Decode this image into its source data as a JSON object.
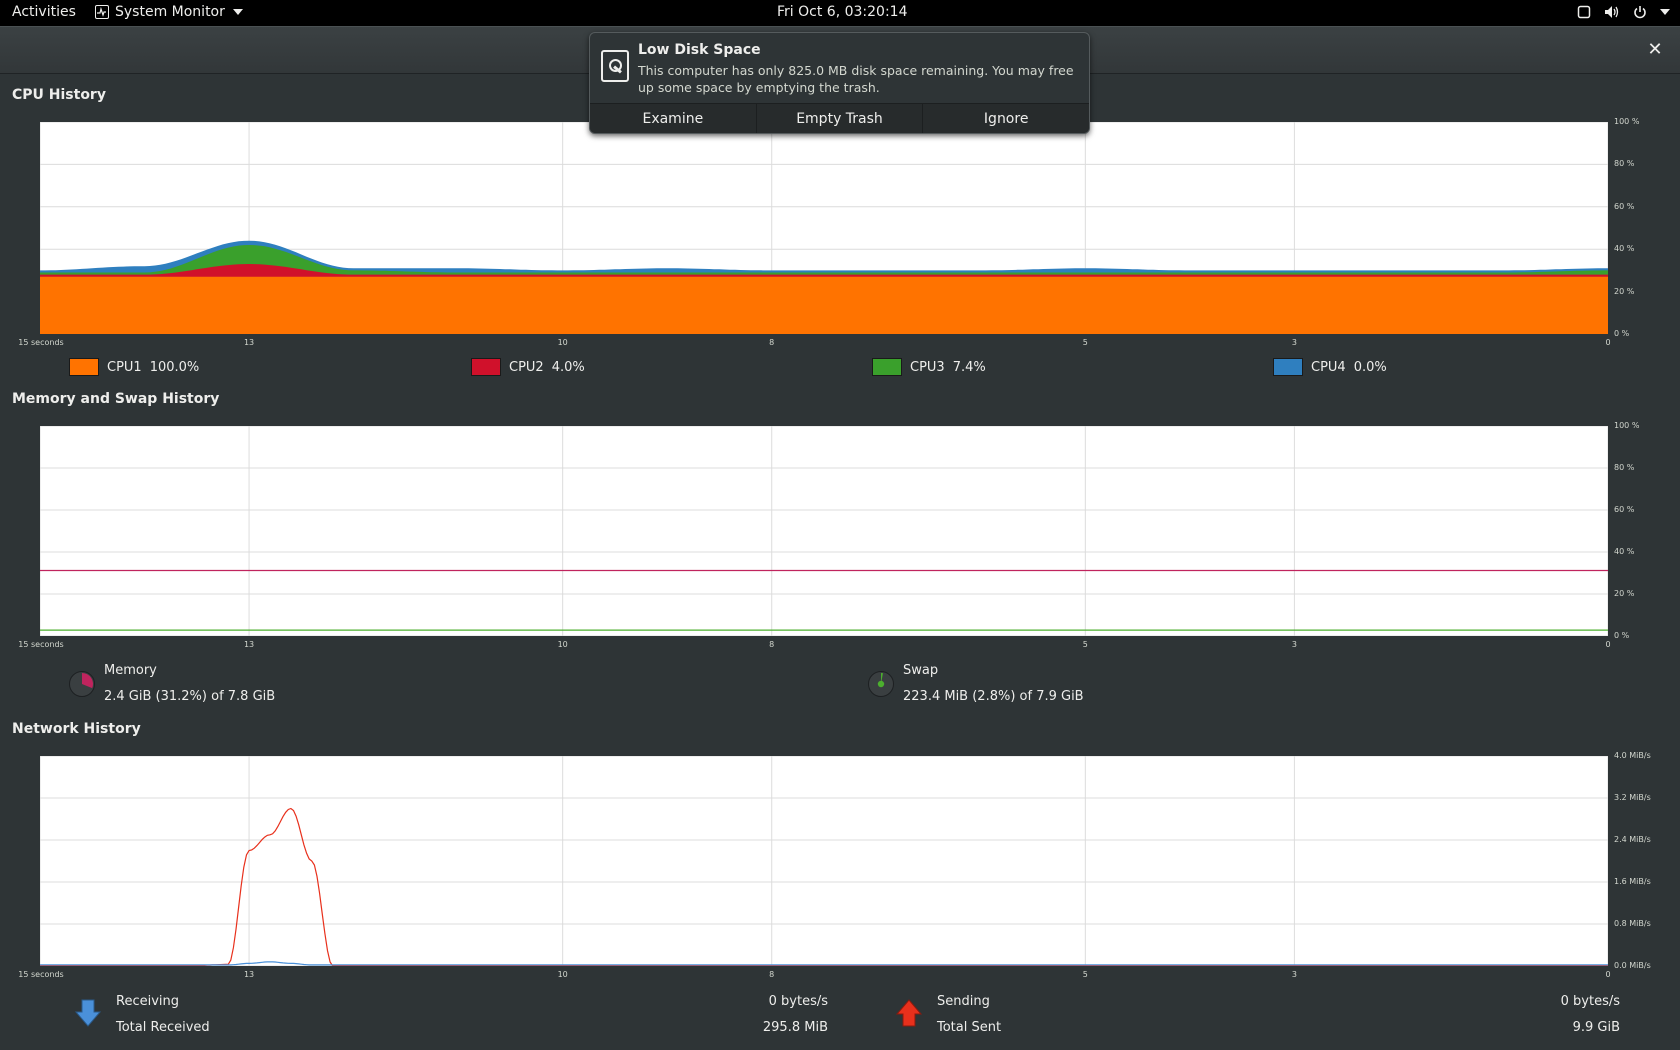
{
  "topbar": {
    "activities": "Activities",
    "app_name": "System Monitor",
    "clock": "Fri Oct  6, 03:20:14"
  },
  "notification": {
    "title": "Low Disk Space",
    "body": "This computer has only 825.0 MB disk space remaining.  You may free up some space by emptying the trash.",
    "actions": [
      "Examine",
      "Empty Trash",
      "Ignore"
    ]
  },
  "sections": {
    "cpu": "CPU History",
    "memory": "Memory and Swap History",
    "network": "Network History"
  },
  "x_axis_labels": [
    "15 seconds",
    "13",
    "10",
    "8",
    "5",
    "3",
    "0"
  ],
  "cpu_y_labels": [
    "100 %",
    "80 %",
    "60 %",
    "40 %",
    "20 %",
    "0 %"
  ],
  "mem_y_labels": [
    "100 %",
    "80 %",
    "60 %",
    "40 %",
    "20 %",
    "0 %"
  ],
  "net_y_labels": [
    "4.0 MiB/s",
    "3.2 MiB/s",
    "2.4 MiB/s",
    "1.6 MiB/s",
    "0.8 MiB/s",
    "0.0 MiB/s"
  ],
  "cpu_legend": [
    {
      "name": "CPU1",
      "value": "100.0%",
      "color": "#ff7300"
    },
    {
      "name": "CPU2",
      "value": "4.0%",
      "color": "#d0112b"
    },
    {
      "name": "CPU3",
      "value": "7.4%",
      "color": "#3aa02c"
    },
    {
      "name": "CPU4",
      "value": "0.0%",
      "color": "#2f7fbf"
    }
  ],
  "memory": {
    "label": "Memory",
    "value": "2.4 GiB (31.2%) of 7.8 GiB",
    "color": "#c0245e",
    "percent": 31.2
  },
  "swap": {
    "label": "Swap",
    "value": "223.4 MiB (2.8%) of 7.9 GiB",
    "color": "#4caf2e",
    "percent": 2.8
  },
  "network": {
    "receiving_label": "Receiving",
    "receiving_value": "0 bytes/s",
    "total_received_label": "Total Received",
    "total_received_value": "295.8 MiB",
    "sending_label": "Sending",
    "sending_value": "0 bytes/s",
    "total_sent_label": "Total Sent",
    "total_sent_value": "9.9 GiB",
    "receiving_color": "#4a90d9",
    "sending_color": "#e8301c"
  },
  "chart_data": [
    {
      "type": "area",
      "xlabel": "",
      "ylabel": "",
      "ylim": [
        0,
        100
      ],
      "x": [
        15,
        14,
        13,
        12,
        11,
        10,
        9,
        8,
        7,
        6,
        5,
        4,
        3,
        2,
        1,
        0
      ],
      "series": [
        {
          "name": "CPU1",
          "values": [
            27,
            27,
            27,
            27,
            27,
            27,
            27,
            27,
            27,
            27,
            27,
            27,
            27,
            27,
            27,
            27
          ]
        },
        {
          "name": "CPU2",
          "values": [
            1,
            1,
            6,
            1,
            1,
            1,
            1,
            1,
            1,
            1,
            1,
            1,
            1,
            1,
            1,
            1
          ]
        },
        {
          "name": "CPU3",
          "values": [
            1,
            1,
            9,
            2,
            1,
            1,
            1,
            1,
            1,
            1,
            1,
            1,
            1,
            1,
            1,
            2
          ]
        },
        {
          "name": "CPU4",
          "values": [
            1,
            3,
            2,
            1,
            2,
            1,
            2,
            1,
            1,
            1,
            2,
            1,
            1,
            1,
            1,
            1
          ]
        }
      ]
    },
    {
      "type": "line",
      "ylim": [
        0,
        100
      ],
      "x": [
        15,
        0
      ],
      "series": [
        {
          "name": "Memory",
          "values": [
            31.2,
            31.2
          ]
        },
        {
          "name": "Swap",
          "values": [
            2.8,
            2.8
          ]
        }
      ]
    },
    {
      "type": "line",
      "ylim": [
        0,
        4.0
      ],
      "x": [
        15,
        14,
        13.6,
        13.2,
        13,
        12.8,
        12.6,
        12.4,
        12.2,
        12,
        0
      ],
      "series": [
        {
          "name": "Receiving",
          "values": [
            0,
            0,
            0,
            0.03,
            2.2,
            2.5,
            3.0,
            2.0,
            0,
            0,
            0
          ]
        },
        {
          "name": "Sending",
          "values": [
            0.02,
            0.02,
            0.02,
            0.02,
            0.05,
            0.08,
            0.05,
            0.02,
            0.02,
            0.02,
            0.02
          ]
        }
      ]
    }
  ]
}
